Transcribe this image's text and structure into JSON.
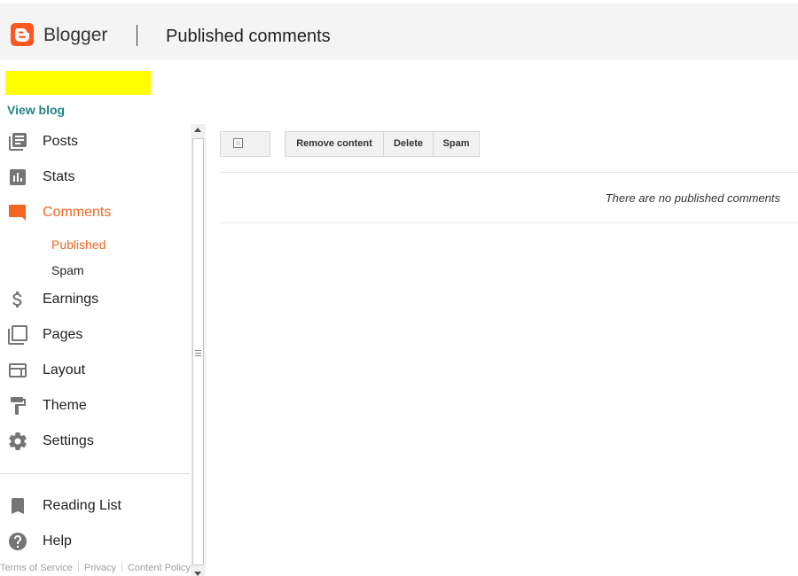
{
  "header": {
    "brand": "Blogger",
    "page_title": "Published comments"
  },
  "sidebar": {
    "view_blog": "View blog",
    "items": [
      {
        "label": "Posts",
        "icon": "posts-icon"
      },
      {
        "label": "Stats",
        "icon": "stats-icon"
      },
      {
        "label": "Comments",
        "icon": "comments-icon",
        "active": true
      },
      {
        "label": "Earnings",
        "icon": "dollar-icon"
      },
      {
        "label": "Pages",
        "icon": "pages-icon"
      },
      {
        "label": "Layout",
        "icon": "layout-icon"
      },
      {
        "label": "Theme",
        "icon": "paint-roller-icon"
      },
      {
        "label": "Settings",
        "icon": "gear-icon"
      },
      {
        "label": "Reading List",
        "icon": "bookmark-icon"
      },
      {
        "label": "Help",
        "icon": "help-icon"
      }
    ],
    "comment_subitems": [
      {
        "label": "Published",
        "active": true
      },
      {
        "label": "Spam"
      }
    ]
  },
  "footer": {
    "terms": "Terms of Service",
    "privacy": "Privacy",
    "content_policy": "Content Policy"
  },
  "toolbar": {
    "remove_label": "Remove content",
    "delete_label": "Delete",
    "spam_label": "Spam"
  },
  "main": {
    "empty_message": "There are no published comments"
  },
  "colors": {
    "accent": "#f26522",
    "brand": "#ff5722",
    "link": "#1e8489",
    "icon_gray": "#757575",
    "blog_name_highlight": "#ffff00"
  }
}
